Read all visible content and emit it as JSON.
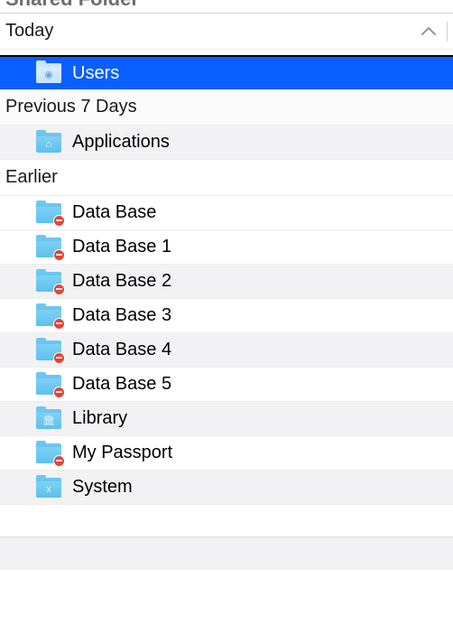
{
  "header": {
    "title": "Shared Folder"
  },
  "sections": {
    "today": {
      "title": "Today",
      "collapsible": true
    },
    "prev7": {
      "title": "Previous 7 Days"
    },
    "earlier": {
      "title": "Earlier"
    }
  },
  "items": {
    "users": {
      "label": "Users",
      "icon": "user-folder",
      "restricted": false
    },
    "applications": {
      "label": "Applications",
      "icon": "app-folder",
      "restricted": false
    },
    "db0": {
      "label": "Data Base",
      "icon": "folder",
      "restricted": true
    },
    "db1": {
      "label": "Data Base 1",
      "icon": "folder",
      "restricted": true
    },
    "db2": {
      "label": "Data Base 2",
      "icon": "folder",
      "restricted": true
    },
    "db3": {
      "label": "Data Base 3",
      "icon": "folder",
      "restricted": true
    },
    "db4": {
      "label": "Data Base 4",
      "icon": "folder",
      "restricted": true
    },
    "db5": {
      "label": "Data Base 5",
      "icon": "folder",
      "restricted": true
    },
    "library": {
      "label": "Library",
      "icon": "library-folder",
      "restricted": false
    },
    "passport": {
      "label": "My Passport",
      "icon": "folder",
      "restricted": true
    },
    "system": {
      "label": "System",
      "icon": "system-folder",
      "restricted": false
    }
  },
  "colors": {
    "selection": "#0a5fff",
    "folder": "#5cc0ee",
    "restricted": "#e74334"
  }
}
